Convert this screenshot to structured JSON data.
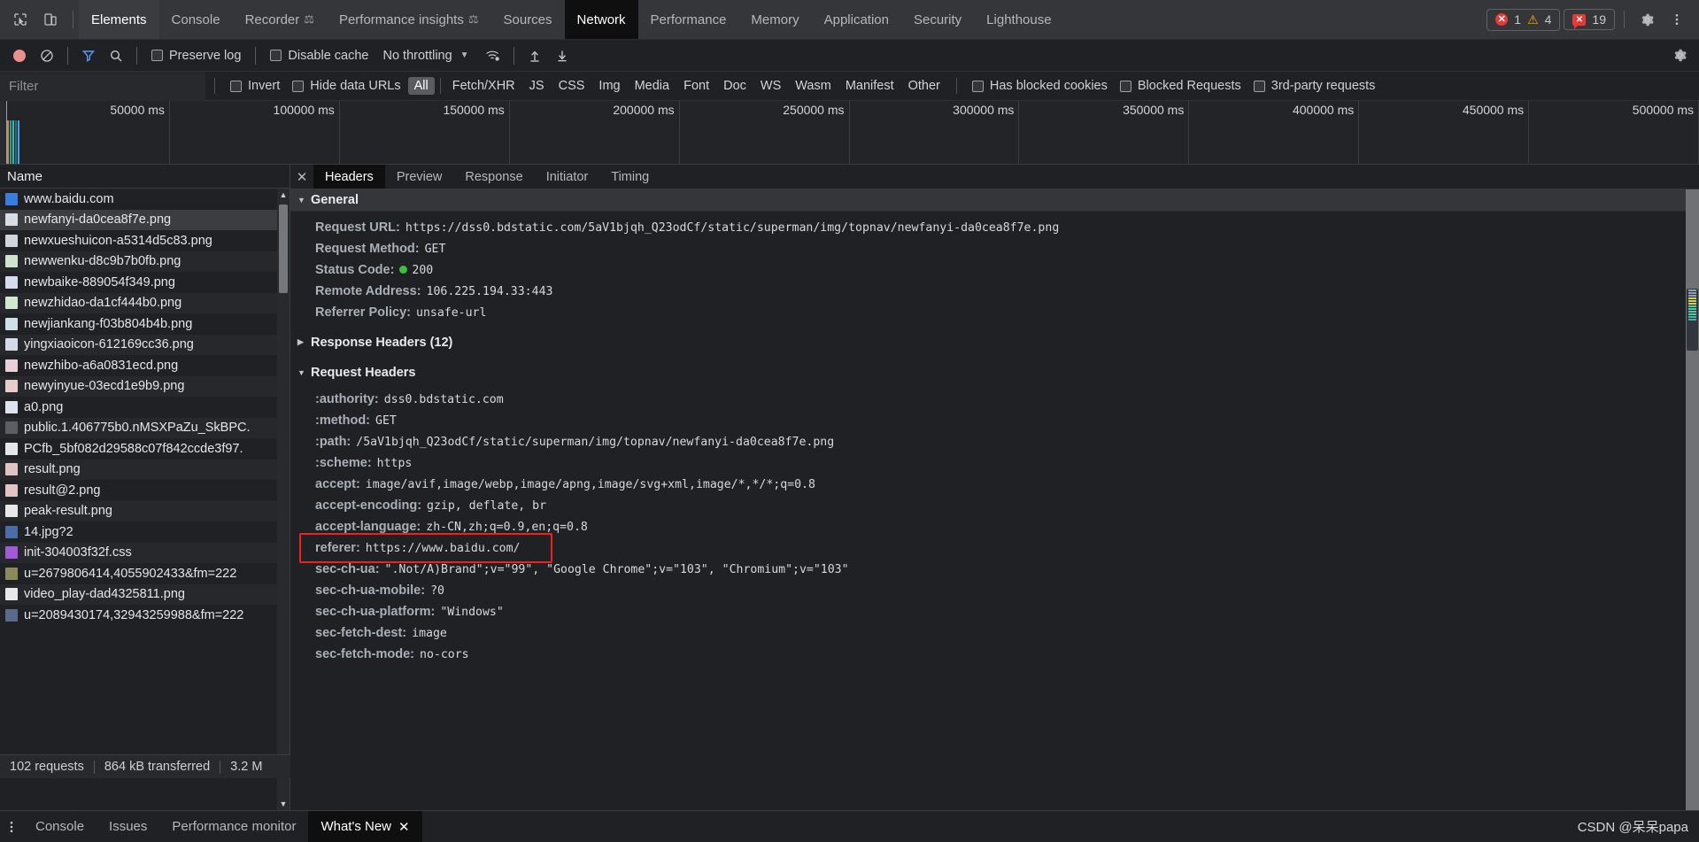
{
  "titlebar": {
    "icons": [
      {
        "name": "inspect-element-icon",
        "glyph": "inspect"
      },
      {
        "name": "device-toolbar-icon",
        "glyph": "device"
      }
    ],
    "tabs": [
      {
        "label": "Elements",
        "state": "secondary",
        "flask": false
      },
      {
        "label": "Console",
        "state": "normal",
        "flask": false
      },
      {
        "label": "Recorder",
        "state": "normal",
        "flask": true
      },
      {
        "label": "Performance insights",
        "state": "normal",
        "flask": true
      },
      {
        "label": "Sources",
        "state": "normal",
        "flask": false
      },
      {
        "label": "Network",
        "state": "active",
        "flask": false
      },
      {
        "label": "Performance",
        "state": "normal",
        "flask": false
      },
      {
        "label": "Memory",
        "state": "normal",
        "flask": false
      },
      {
        "label": "Application",
        "state": "normal",
        "flask": false
      },
      {
        "label": "Security",
        "state": "normal",
        "flask": false
      },
      {
        "label": "Lighthouse",
        "state": "normal",
        "flask": false
      }
    ],
    "error_count": "1",
    "warning_count": "4",
    "issues_count": "19",
    "settings_icon": "gear-icon",
    "more_icon": "more-vertical-icon"
  },
  "network_toolbar": {
    "record_title": "record-button",
    "clear_title": "clear-button",
    "filter_title": "filter-button",
    "search_title": "search-button",
    "preserve_log_label": "Preserve log",
    "disable_cache_label": "Disable cache",
    "throttling_value": "No throttling",
    "throttling_caret": "▼",
    "wifi_title": "network-conditions-icon",
    "import_title": "import-har-icon",
    "export_title": "export-har-icon",
    "settings_title": "network-settings-icon"
  },
  "filter_row": {
    "filter_placeholder": "Filter",
    "filter_value": "",
    "invert_label": "Invert",
    "hide_data_urls_label": "Hide data URLs",
    "types": [
      {
        "label": "All",
        "selected": true
      },
      {
        "label": "Fetch/XHR",
        "selected": false
      },
      {
        "label": "JS",
        "selected": false
      },
      {
        "label": "CSS",
        "selected": false
      },
      {
        "label": "Img",
        "selected": false
      },
      {
        "label": "Media",
        "selected": false
      },
      {
        "label": "Font",
        "selected": false
      },
      {
        "label": "Doc",
        "selected": false
      },
      {
        "label": "WS",
        "selected": false
      },
      {
        "label": "Wasm",
        "selected": false
      },
      {
        "label": "Manifest",
        "selected": false
      },
      {
        "label": "Other",
        "selected": false
      }
    ],
    "has_blocked_cookies_label": "Has blocked cookies",
    "blocked_requests_label": "Blocked Requests",
    "third_party_label": "3rd-party requests"
  },
  "overview": {
    "ticks": [
      "50000 ms",
      "100000 ms",
      "150000 ms",
      "200000 ms",
      "250000 ms",
      "300000 ms",
      "350000 ms",
      "400000 ms",
      "450000 ms",
      "500000 ms"
    ],
    "activity_colors": [
      "#c98a4b",
      "#2e9e8f",
      "#3bb8a8",
      "#1f6f8f",
      "#4aa3d8"
    ]
  },
  "request_list": {
    "column_header": "Name",
    "rows": [
      {
        "name": "www.baidu.com",
        "icon": "#3b7ddd",
        "selected": false
      },
      {
        "name": "newfanyi-da0cea8f7e.png",
        "icon": "#d8dde4",
        "selected": true
      },
      {
        "name": "newxueshuicon-a5314d5c83.png",
        "icon": "#cfd6de",
        "selected": false
      },
      {
        "name": "newwenku-d8c9b7b0fb.png",
        "icon": "#cfe4cf",
        "selected": false
      },
      {
        "name": "newbaike-889054f349.png",
        "icon": "#d4dced",
        "selected": false
      },
      {
        "name": "newzhidao-da1cf444b0.png",
        "icon": "#d0e8d0",
        "selected": false
      },
      {
        "name": "newjiankang-f03b804b4b.png",
        "icon": "#cfe0e8",
        "selected": false
      },
      {
        "name": "yingxiaoicon-612169cc36.png",
        "icon": "#d6d9e8",
        "selected": false
      },
      {
        "name": "newzhibo-a6a0831ecd.png",
        "icon": "#e8cfd9",
        "selected": false
      },
      {
        "name": "newyinyue-03ecd1e9b9.png",
        "icon": "#e8cccc",
        "selected": false
      },
      {
        "name": "a0.png",
        "icon": "#dde4f0",
        "selected": false
      },
      {
        "name": "public.1.406775b0.nMSXPaZu_SkBPC.",
        "icon": "#5b5e62",
        "selected": false
      },
      {
        "name": "PCfb_5bf082d29588c07f842ccde3f97.",
        "icon": "#e4e6e8",
        "selected": false
      },
      {
        "name": "result.png",
        "icon": "#e0c4c4",
        "selected": false
      },
      {
        "name": "result@2.png",
        "icon": "#e0c4c4",
        "selected": false
      },
      {
        "name": "peak-result.png",
        "icon": "#e8e8e8",
        "selected": false
      },
      {
        "name": "14.jpg?2",
        "icon": "#4a6ea8",
        "selected": false
      },
      {
        "name": "init-304003f32f.css",
        "icon": "#a259d9",
        "selected": false
      },
      {
        "name": "u=2679806414,4055902433&fm=222",
        "icon": "#8a8a5a",
        "selected": false
      },
      {
        "name": "video_play-dad4325811.png",
        "icon": "#e8e8e8",
        "selected": false
      },
      {
        "name": "u=2089430174,32943259988&fm=222",
        "icon": "#5a6a8a",
        "selected": false
      }
    ]
  },
  "status_bar": {
    "requests": "102 requests",
    "transferred": "864 kB transferred",
    "resources": "3.2 M"
  },
  "detail": {
    "close_icon": "close-icon",
    "tabs": [
      {
        "label": "Headers",
        "active": true
      },
      {
        "label": "Preview",
        "active": false
      },
      {
        "label": "Response",
        "active": false
      },
      {
        "label": "Initiator",
        "active": false
      },
      {
        "label": "Timing",
        "active": false
      }
    ],
    "general": {
      "title": "General",
      "expanded": true,
      "rows": [
        {
          "key": "Request URL:",
          "value": "https://dss0.bdstatic.com/5aV1bjqh_Q23odCf/static/superman/img/topnav/newfanyi-da0cea8f7e.png",
          "status": false
        },
        {
          "key": "Request Method:",
          "value": "GET",
          "status": false
        },
        {
          "key": "Status Code:",
          "value": "200",
          "status": true
        },
        {
          "key": "Remote Address:",
          "value": "106.225.194.33:443",
          "status": false
        },
        {
          "key": "Referrer Policy:",
          "value": "unsafe-url",
          "status": false
        }
      ]
    },
    "response_headers": {
      "title": "Response Headers (12)",
      "expanded": false
    },
    "request_headers": {
      "title": "Request Headers",
      "expanded": true,
      "rows": [
        {
          "key": ":authority:",
          "value": "dss0.bdstatic.com",
          "highlight": false
        },
        {
          "key": ":method:",
          "value": "GET",
          "highlight": false
        },
        {
          "key": ":path:",
          "value": "/5aV1bjqh_Q23odCf/static/superman/img/topnav/newfanyi-da0cea8f7e.png",
          "highlight": false
        },
        {
          "key": ":scheme:",
          "value": "https",
          "highlight": false
        },
        {
          "key": "accept:",
          "value": "image/avif,image/webp,image/apng,image/svg+xml,image/*,*/*;q=0.8",
          "highlight": false
        },
        {
          "key": "accept-encoding:",
          "value": "gzip, deflate, br",
          "highlight": false
        },
        {
          "key": "accept-language:",
          "value": "zh-CN,zh;q=0.9,en;q=0.8",
          "highlight": false
        },
        {
          "key": "referer:",
          "value": "https://www.baidu.com/",
          "highlight": true
        },
        {
          "key": "sec-ch-ua:",
          "value": "\".Not/A)Brand\";v=\"99\", \"Google Chrome\";v=\"103\", \"Chromium\";v=\"103\"",
          "highlight": false
        },
        {
          "key": "sec-ch-ua-mobile:",
          "value": "?0",
          "highlight": false
        },
        {
          "key": "sec-ch-ua-platform:",
          "value": "\"Windows\"",
          "highlight": false
        },
        {
          "key": "sec-fetch-dest:",
          "value": "image",
          "highlight": false
        },
        {
          "key": "sec-fetch-mode:",
          "value": "no-cors",
          "highlight": false
        }
      ]
    },
    "annotation_color": "#f02020"
  },
  "drawer": {
    "more_icon": "more-vertical-icon",
    "tabs": [
      {
        "label": "Console",
        "active": false,
        "closable": false
      },
      {
        "label": "Issues",
        "active": false,
        "closable": false
      },
      {
        "label": "Performance monitor",
        "active": false,
        "closable": false
      },
      {
        "label": "What's New",
        "active": true,
        "closable": true
      }
    ],
    "close_glyph": "✕",
    "watermark": "CSDN @呆呆papa"
  }
}
